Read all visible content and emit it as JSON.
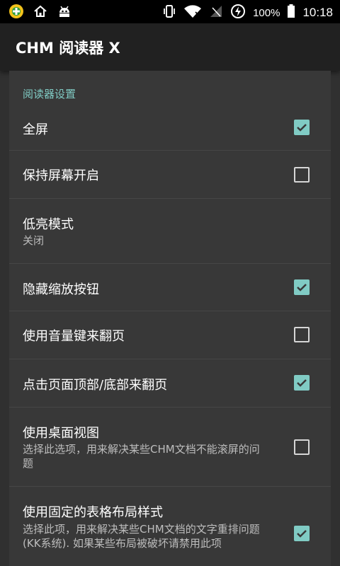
{
  "status_bar": {
    "battery_percent": "100%",
    "time": "10:18"
  },
  "app": {
    "title": "CHM 阅读器 X"
  },
  "section": {
    "header": "阅读器设置"
  },
  "prefs": [
    {
      "title": "全屏",
      "summary": "",
      "checkbox": true,
      "checked": true
    },
    {
      "title": "保持屏幕开启",
      "summary": "",
      "checkbox": true,
      "checked": false
    },
    {
      "title": "低亮模式",
      "summary": "关闭",
      "checkbox": false,
      "checked": false
    },
    {
      "title": "隐藏缩放按钮",
      "summary": "",
      "checkbox": true,
      "checked": true
    },
    {
      "title": "使用音量键来翻页",
      "summary": "",
      "checkbox": true,
      "checked": false
    },
    {
      "title": "点击页面顶部/底部来翻页",
      "summary": "",
      "checkbox": true,
      "checked": true
    },
    {
      "title": "使用桌面视图",
      "summary": "选择此选项，用来解决某些CHM文档不能滚屏的问题",
      "checkbox": true,
      "checked": false
    },
    {
      "title": "使用固定的表格布局样式",
      "summary": "选择此项，用来解决某些CHM文档的文字重排问题(KK系统). 如果某些布局被破坏请禁用此项",
      "checkbox": true,
      "checked": true
    }
  ],
  "colors": {
    "accent": "#80cbc4",
    "toolbar": "#212121",
    "list_background": "#383838"
  }
}
